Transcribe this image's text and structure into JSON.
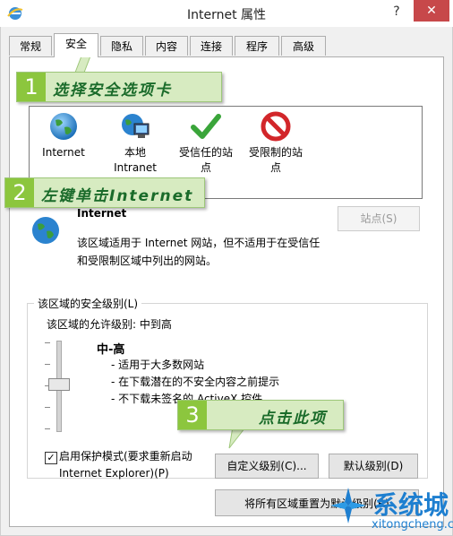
{
  "window": {
    "title": "Internet 属性",
    "help_label": "?",
    "close_label": "✕"
  },
  "tabs": [
    {
      "label": "常规"
    },
    {
      "label": "安全"
    },
    {
      "label": "隐私"
    },
    {
      "label": "内容"
    },
    {
      "label": "连接"
    },
    {
      "label": "程序"
    },
    {
      "label": "高级"
    }
  ],
  "callouts": [
    {
      "num": "1",
      "text": "选择安全选项卡"
    },
    {
      "num": "2",
      "text": "左键单击Internet"
    },
    {
      "num": "3",
      "text": "点击此项"
    }
  ],
  "zones": [
    {
      "label": "Internet",
      "icon": "globe-icon"
    },
    {
      "label": "本地\nIntranet",
      "icon": "intranet-icon"
    },
    {
      "label": "受信任的站\n点",
      "icon": "checkmark-icon"
    },
    {
      "label": "受限制的站\n点",
      "icon": "prohibited-icon"
    }
  ],
  "zone_info": {
    "name": "Internet",
    "description": "该区域适用于 Internet 网站，但不适用于在受信任\n和受限制区域中列出的网站。",
    "sites_button": "站点(S)"
  },
  "security_level": {
    "group_label": "该区域的安全级别(L)",
    "allowed_label": "该区域的允许级别: 中到高",
    "level_name": "中-高",
    "bullets": [
      "- 适用于大多数网站",
      "- 在下载潜在的不安全内容之前提示",
      "- 不下载未签名的 ActiveX 控件"
    ],
    "protected_mode_label": "启用保护模式(要求重新启动\nInternet Explorer)(P)",
    "protected_mode_checked": true,
    "custom_button": "自定义级别(C)...",
    "default_button": "默认级别(D)",
    "reset_all_button": "将所有区域重置为默认级别(R)"
  },
  "watermark": {
    "brand": "系统城",
    "url": "xitongcheng.com"
  },
  "colors": {
    "callout_bg": "#d7ebc1",
    "callout_num_bg": "#8cc63e",
    "close_bg": "#c7484a",
    "watermark_blue": "#1e7fd0"
  }
}
